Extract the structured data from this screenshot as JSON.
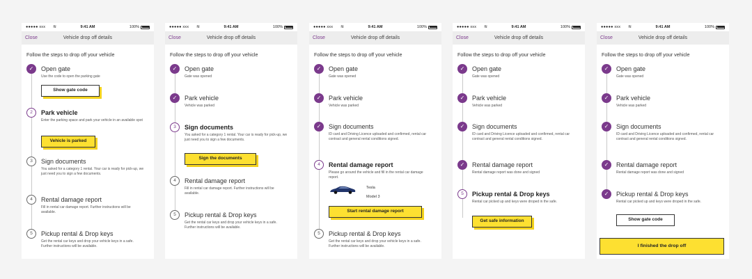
{
  "status": {
    "carrier": "●●●●● xxx",
    "wifi": "wifi-icon",
    "time": "9:41 AM",
    "battery": "100%"
  },
  "nav": {
    "close": "Close",
    "title": "Vehicle drop off details"
  },
  "intro": "Follow the steps to drop off your vehicle",
  "steps": {
    "open_gate": {
      "title": "Open gate",
      "desc_active": "Use the code to open the parking gate",
      "desc_done": "Gate was opened"
    },
    "park": {
      "title": "Park vehicle",
      "desc_active": "Enter the parking space and park your vehicle in an available spot",
      "desc_done": "Vehicle was parked"
    },
    "sign": {
      "title": "Sign documents",
      "desc_todo": "You asked for a category 1 rental. Your car is ready for pick-up, we just need you to sign a few documents.",
      "desc_done": "ID card and Driving Licence uploaded and confirmed, rental car contract and general rental conditions signed."
    },
    "damage": {
      "title": "Rental damage report",
      "desc_todo": "Fill in rental  car damage report. Further instructions will be available.",
      "desc_active": "Please go around the vehicle and fill in the rental car damage report.",
      "desc_done": "Rental damage report was done and signed"
    },
    "pickup": {
      "title": "Pickup rental & Drop keys",
      "desc_todo": "Get the rental car keys and drop your vehicle keys in a safe. Further instructions will be available.",
      "desc_done": "Rental car picked up and keys were droped in the safe."
    }
  },
  "numbers": {
    "s2": "2",
    "s3": "3",
    "s4": "4",
    "s5": "5"
  },
  "check": "✓",
  "buttons": {
    "show_gate_code": "Show gate code",
    "vehicle_parked": "Vehicle is parked",
    "sign_documents": "Sign the documents",
    "start_damage": "Start rental damage report",
    "get_safe": "Get safe information",
    "finished": "I finished the drop off"
  },
  "car": {
    "make": "Tesla",
    "model": "Model 3"
  },
  "colors": {
    "accent": "#7b3a8c",
    "button_yellow": "#fde031"
  }
}
